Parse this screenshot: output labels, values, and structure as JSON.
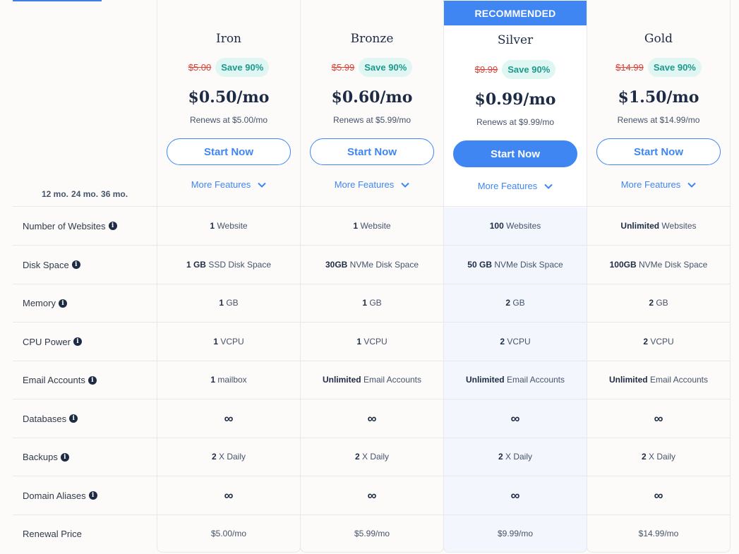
{
  "billing_periods": [
    "12 mo.",
    "24 mo.",
    "36 mo."
  ],
  "recommended_label": "RECOMMENDED",
  "plans": [
    {
      "name": "Iron",
      "old_price": "$5.00",
      "save": "Save 90%",
      "price": "$0.50/mo",
      "renews": "Renews at $5.00/mo",
      "cta": "Start Now",
      "more": "More Features"
    },
    {
      "name": "Bronze",
      "old_price": "$5.99",
      "save": "Save 90%",
      "price": "$0.60/mo",
      "renews": "Renews at $5.99/mo",
      "cta": "Start Now",
      "more": "More Features"
    },
    {
      "name": "Silver",
      "old_price": "$9.99",
      "save": "Save 90%",
      "price": "$0.99/mo",
      "renews": "Renews at $9.99/mo",
      "cta": "Start Now",
      "more": "More Features"
    },
    {
      "name": "Gold",
      "old_price": "$14.99",
      "save": "Save 90%",
      "price": "$1.50/mo",
      "renews": "Renews at $14.99/mo",
      "cta": "Start Now",
      "more": "More Features"
    }
  ],
  "features": [
    {
      "label": "Number of Websites",
      "info": true,
      "cells": [
        [
          "1",
          " Website"
        ],
        [
          "1",
          " Website"
        ],
        [
          "100",
          " Websites"
        ],
        [
          "Unlimited",
          " Websites"
        ]
      ]
    },
    {
      "label": "Disk Space",
      "info": true,
      "cells": [
        [
          "1 GB",
          " SSD Disk Space"
        ],
        [
          "30GB",
          " NVMe Disk Space"
        ],
        [
          "50 GB",
          " NVMe Disk Space"
        ],
        [
          "100GB",
          " NVMe Disk Space"
        ]
      ]
    },
    {
      "label": "Memory",
      "info": true,
      "cells": [
        [
          "1",
          " GB"
        ],
        [
          "1",
          " GB"
        ],
        [
          "2",
          " GB"
        ],
        [
          "2",
          " GB"
        ]
      ]
    },
    {
      "label": "CPU Power",
      "info": true,
      "cells": [
        [
          "1",
          " VCPU"
        ],
        [
          "1",
          " VCPU"
        ],
        [
          "2",
          " VCPU"
        ],
        [
          "2",
          " VCPU"
        ]
      ]
    },
    {
      "label": "Email Accounts",
      "info": true,
      "cells": [
        [
          "1",
          " mailbox"
        ],
        [
          "Unlimited",
          " Email Accounts"
        ],
        [
          "Unlimited",
          " Email Accounts"
        ],
        [
          "Unlimited",
          " Email Accounts"
        ]
      ]
    },
    {
      "label": "Databases",
      "info": true,
      "cells": [
        [
          "∞",
          ""
        ],
        [
          "∞",
          ""
        ],
        [
          "∞",
          ""
        ],
        [
          "∞",
          ""
        ]
      ]
    },
    {
      "label": "Backups",
      "info": true,
      "cells": [
        [
          "2",
          " X Daily"
        ],
        [
          "2",
          " X Daily"
        ],
        [
          "2",
          " X Daily"
        ],
        [
          "2",
          " X Daily"
        ]
      ]
    },
    {
      "label": "Domain Aliases",
      "info": true,
      "cells": [
        [
          "∞",
          ""
        ],
        [
          "∞",
          ""
        ],
        [
          "∞",
          ""
        ],
        [
          "∞",
          ""
        ]
      ]
    },
    {
      "label": "Renewal Price",
      "info": false,
      "cells": [
        [
          "",
          "$5.00/mo"
        ],
        [
          "",
          "$5.99/mo"
        ],
        [
          "",
          "$9.99/mo"
        ],
        [
          "",
          "$14.99/mo"
        ]
      ]
    }
  ],
  "colors": {
    "accent": "#3f86f2",
    "save_text": "#1b9a8c",
    "save_bg": "#dff6f3",
    "old_price": "#d9433a"
  }
}
